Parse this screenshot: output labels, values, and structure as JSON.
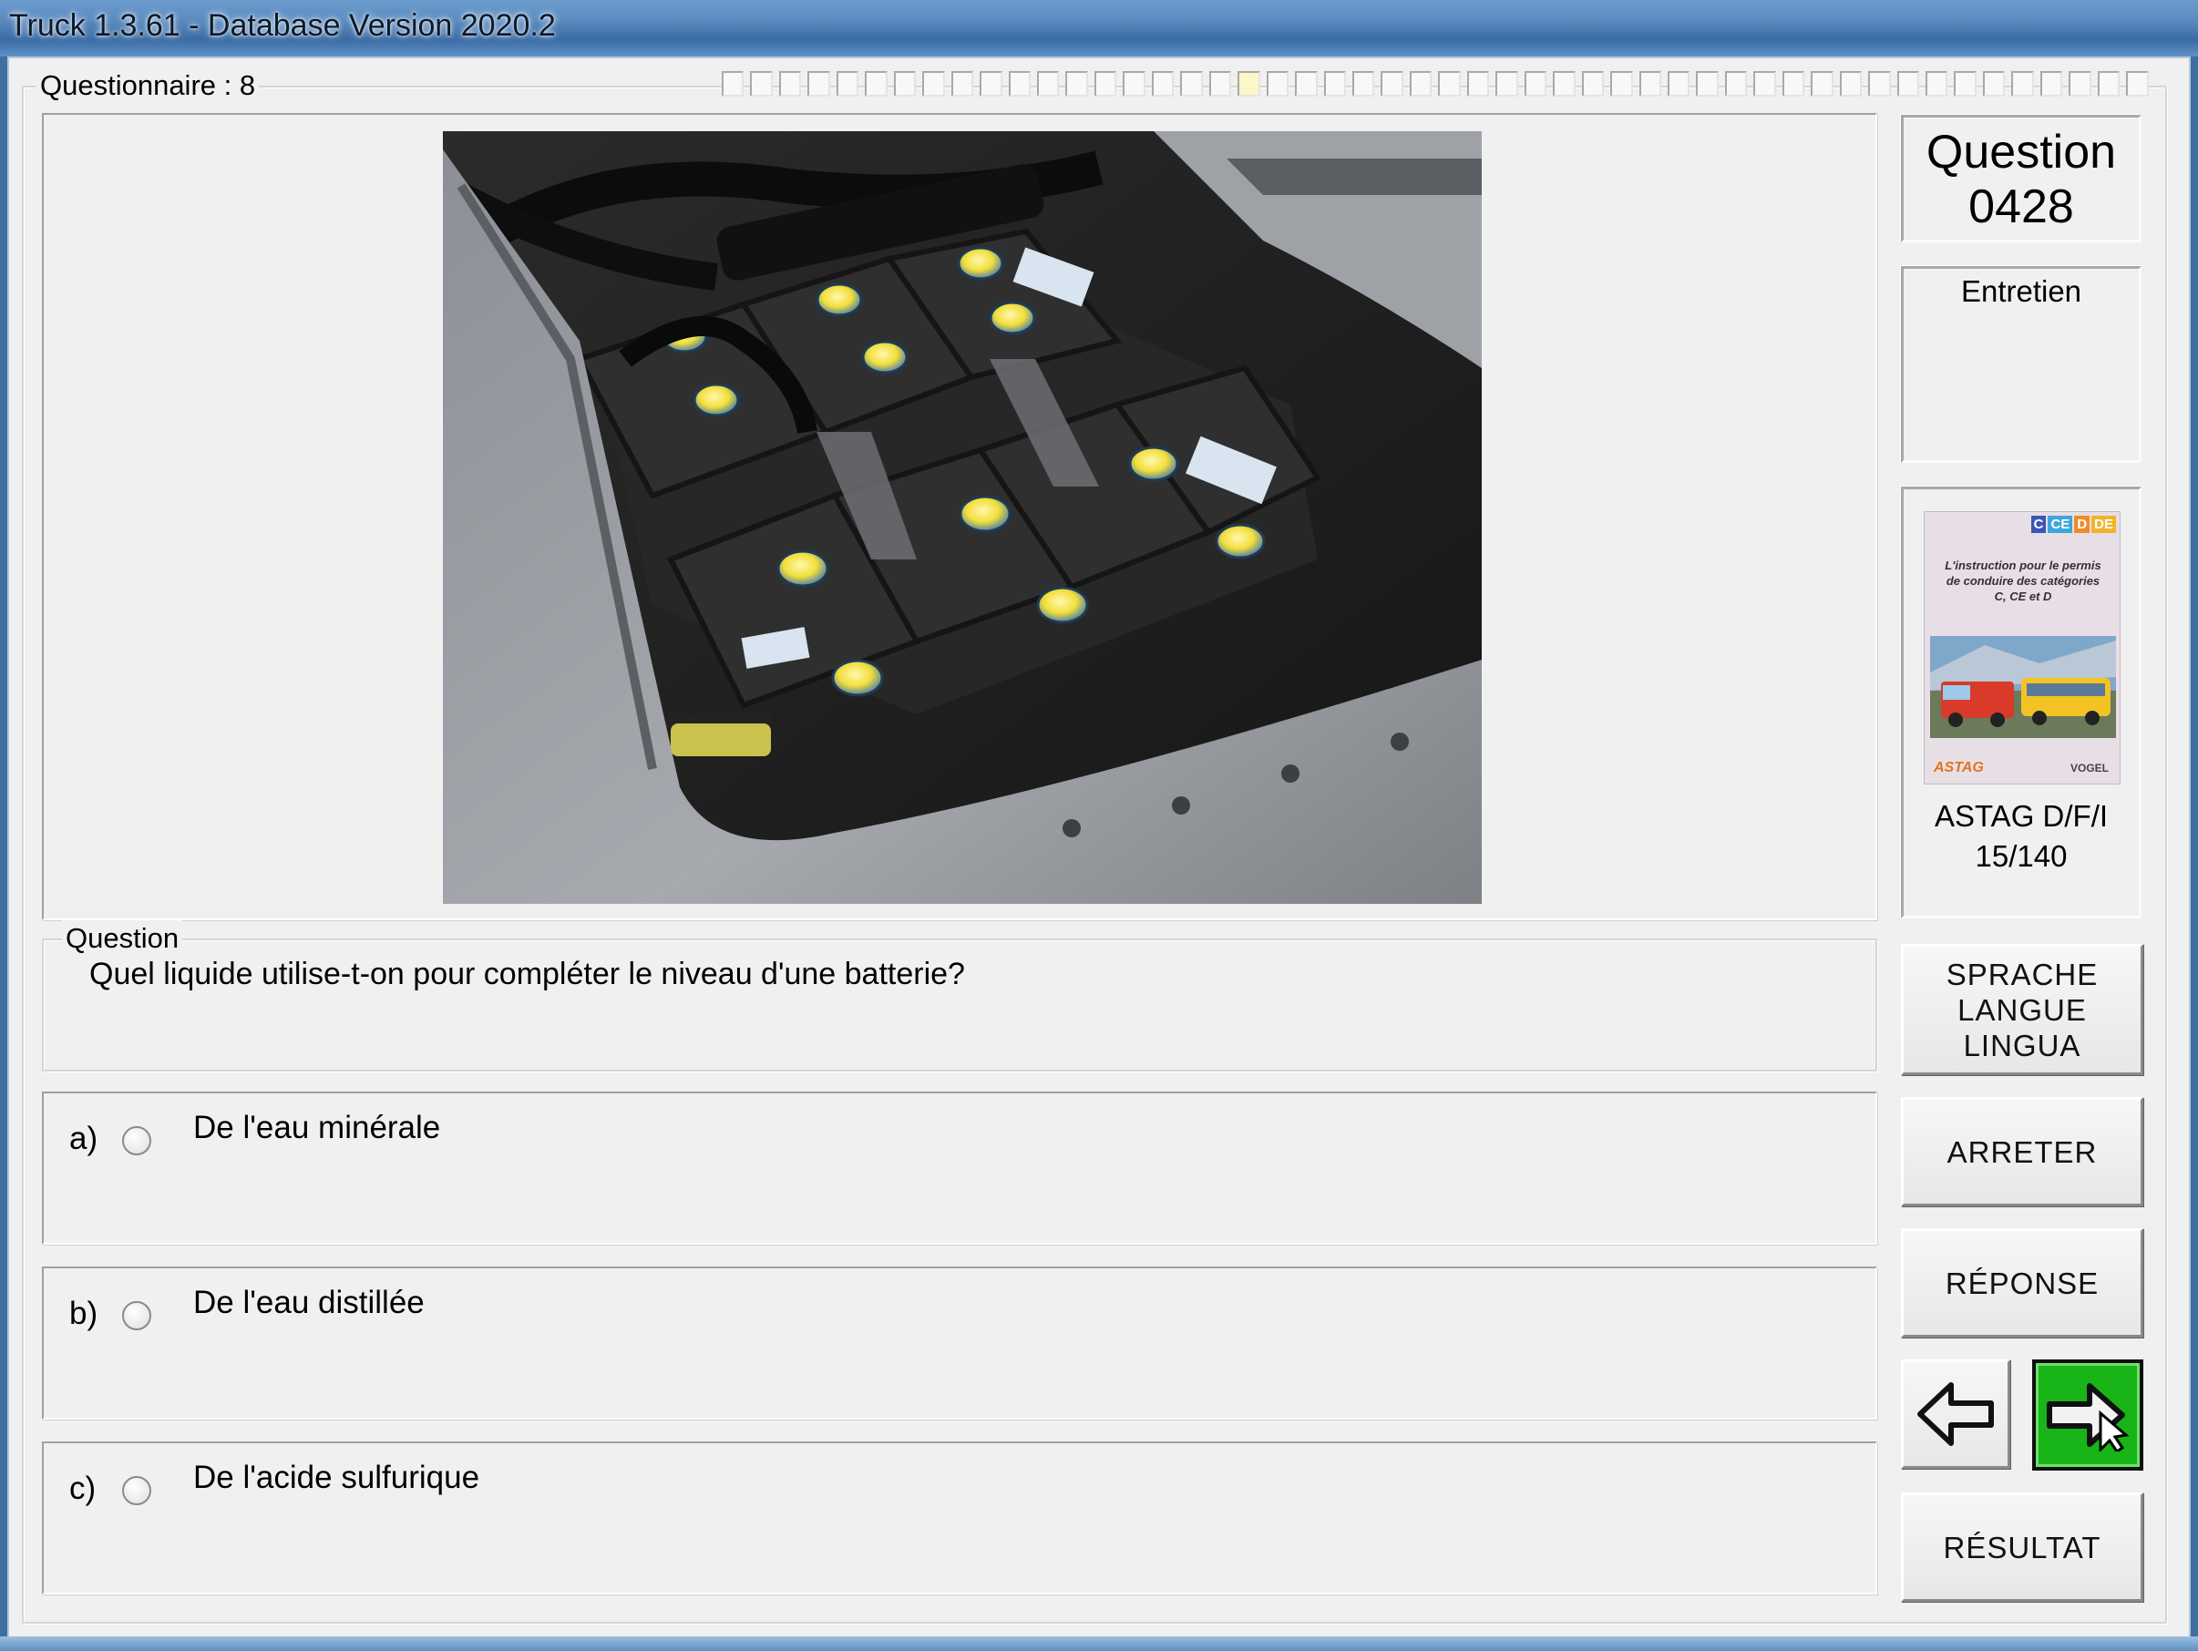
{
  "window": {
    "title": "Truck 1.3.61 - Database Version 2020.2"
  },
  "questionnaire": {
    "label": "Questionnaire : 8",
    "total_cells": 50,
    "current_cell_index": 18
  },
  "question": {
    "group_label": "Question",
    "text": "Quel liquide utilise-t-on pour compléter le niveau d'une batterie?",
    "image_alt": "Batteries de camion dans leur compartiment"
  },
  "answers": [
    {
      "letter": "a)",
      "text": "De l'eau minérale",
      "selected": false
    },
    {
      "letter": "b)",
      "text": "De l'eau distillée",
      "selected": false
    },
    {
      "letter": "c)",
      "text": "De l'acide sulfurique",
      "selected": false
    }
  ],
  "sidebar": {
    "question_label": "Question",
    "question_number": "0428",
    "category": "Entretien",
    "book": {
      "cover_badges": [
        "C",
        "CE",
        "D",
        "DE"
      ],
      "cover_text": "L'instruction pour le permis de conduire des catégories C, CE et D",
      "publisher_left": "ASTAG",
      "publisher_right": "VOGEL",
      "caption_line1": "ASTAG D/F/I",
      "caption_line2": "15/140"
    },
    "buttons": {
      "language": [
        "SPRACHE",
        "LANGUE",
        "LINGUA"
      ],
      "stop": "ARRETER",
      "answer": "RÉPONSE",
      "result": "RÉSULTAT"
    }
  },
  "colors": {
    "next_button_green": "#18b418",
    "window_frame_blue": "#5b8bc0",
    "battery_cap_yellow": "#f2df3a"
  }
}
